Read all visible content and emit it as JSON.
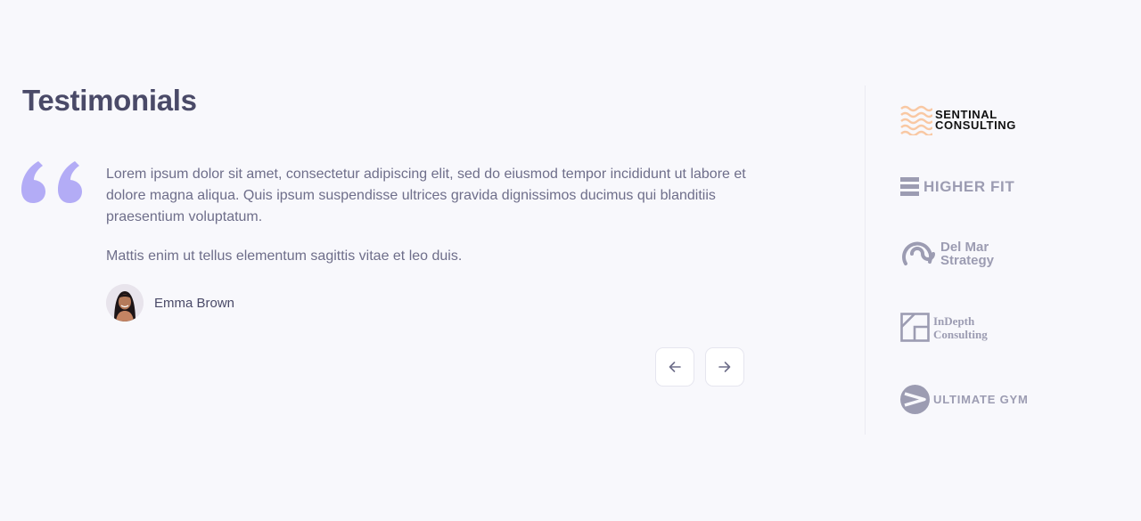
{
  "section": {
    "title": "Testimonials"
  },
  "testimonial": {
    "paragraphs": [
      "Lorem ipsum dolor sit amet, consectetur adipiscing elit, sed do eiusmod tempor incididunt ut labore et dolore magna aliqua. Quis ipsum suspendisse ultrices gravida dignissimos ducimus qui blanditiis praesentium voluptatum.",
      "Mattis enim ut tellus elementum sagittis vitae et leo duis."
    ],
    "author": "Emma Brown"
  },
  "navigation": {
    "prev_icon": "arrow-left-icon",
    "next_icon": "arrow-right-icon"
  },
  "logos": {
    "sentinal": {
      "line1": "SENTINAL",
      "line2": "CONSULTING",
      "accent": "#f9c8a3"
    },
    "higherfit": {
      "text": "HIGHER FIT"
    },
    "delmar": {
      "line1": "Del Mar",
      "line2": "Strategy"
    },
    "indepth": {
      "line1": "InDepth",
      "line2": "Consulting"
    },
    "ultimategym": {
      "text": "ULTIMATE GYM"
    }
  },
  "colors": {
    "quote_accent": "#b3acf6",
    "logo_gray": "#9c9cb2",
    "heading": "#4a4a68",
    "text": "#6e6e8a"
  }
}
